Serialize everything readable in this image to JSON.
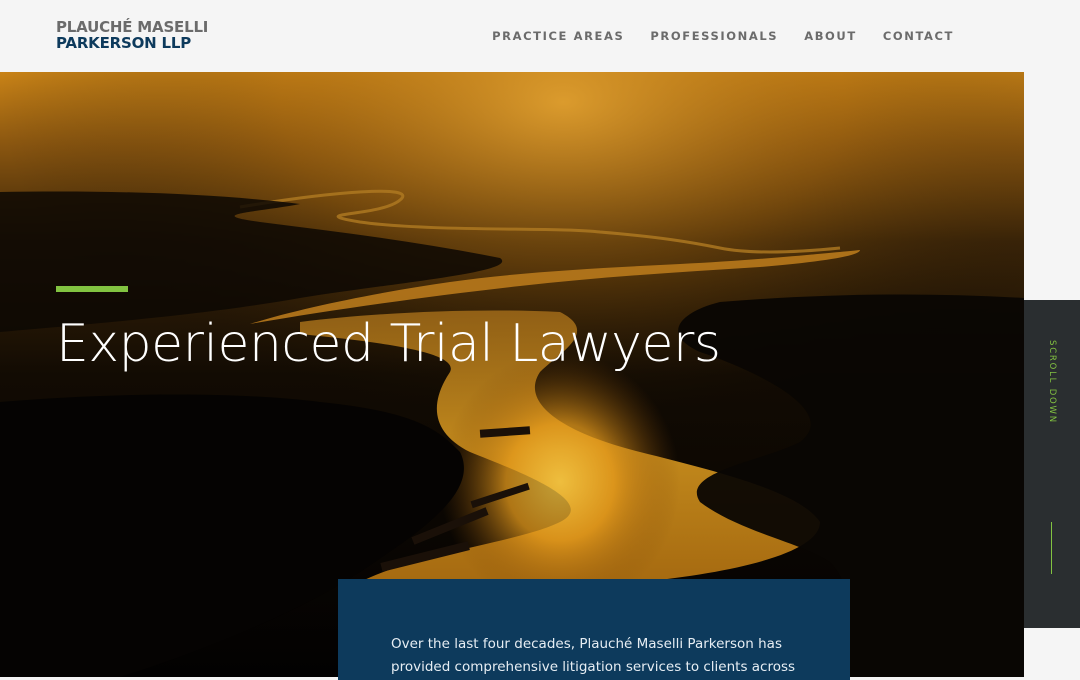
{
  "logo": {
    "line1": "PLAUCHÉ MASELLI",
    "line2": "PARKERSON LLP"
  },
  "nav": {
    "items": [
      {
        "label": "PRACTICE AREAS"
      },
      {
        "label": "PROFESSIONALS"
      },
      {
        "label": "ABOUT"
      },
      {
        "label": "CONTACT"
      }
    ]
  },
  "hero": {
    "title": "Experienced Trial Lawyers",
    "image": "aerial-river-sunset-photo"
  },
  "intro": {
    "text": "Over the last four decades, Plauché Maselli Parkerson has provided comprehensive litigation services to clients across"
  },
  "scroll": {
    "label": "SCROLL DOWN"
  },
  "colors": {
    "brand_navy": "#0d3a5c",
    "accent_green": "#82c341",
    "header_bg": "#f5f5f5",
    "nav_text": "#6b6b6b",
    "scroll_panel_bg": "#2a2e30"
  }
}
